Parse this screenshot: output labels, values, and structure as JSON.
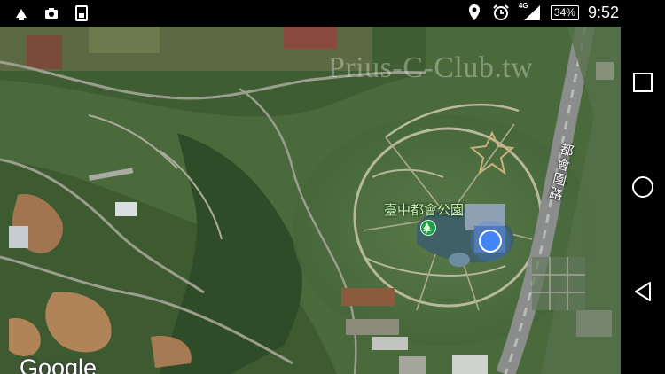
{
  "status_bar": {
    "time": "9:52",
    "battery": "34%",
    "network": "4G",
    "icons": [
      "usb-icon",
      "camera-icon",
      "sim-icon",
      "location-icon",
      "alarm-icon",
      "signal-icon",
      "battery-icon"
    ]
  },
  "map": {
    "watermark": "Prius-C-Club.tw",
    "park_label": "臺中都會公園",
    "road_label": "都會園路",
    "attribution": "Google",
    "icons": [
      "park-pin-icon",
      "my-location-dot"
    ]
  },
  "nav_bar": {
    "buttons": [
      "recent-apps-button",
      "home-button",
      "back-button"
    ]
  }
}
